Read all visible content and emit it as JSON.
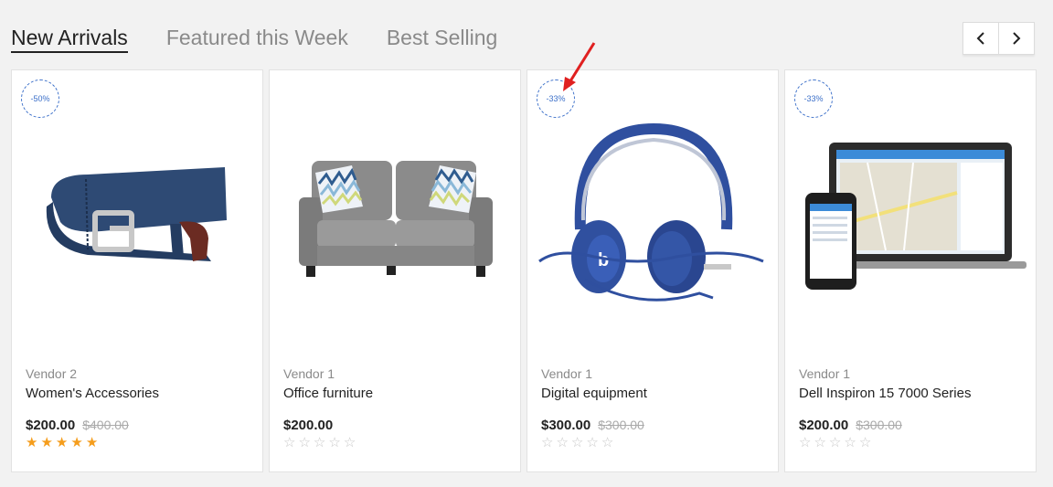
{
  "tabs": [
    {
      "label": "New Arrivals",
      "active": true
    },
    {
      "label": "Featured this Week",
      "active": false
    },
    {
      "label": "Best Selling",
      "active": false
    }
  ],
  "nav": {
    "prev_icon": "chevron-left-icon",
    "next_icon": "chevron-right-icon"
  },
  "products": [
    {
      "badge": "-50%",
      "vendor": "Vendor 2",
      "title": "Women's Accessories",
      "price": "$200.00",
      "old_price": "$400.00",
      "rating": 5,
      "image": "belt"
    },
    {
      "badge": "",
      "vendor": "Vendor 1",
      "title": "Office furniture",
      "price": "$200.00",
      "old_price": "",
      "rating": 0,
      "image": "sofa"
    },
    {
      "badge": "-33%",
      "vendor": "Vendor 1",
      "title": "Digital equipment",
      "price": "$300.00",
      "old_price": "$300.00",
      "rating": 0,
      "image": "headphones"
    },
    {
      "badge": "-33%",
      "vendor": "Vendor 1",
      "title": "Dell Inspiron 15 7000 Series",
      "price": "$200.00",
      "old_price": "$300.00",
      "rating": 0,
      "image": "laptop-phone"
    }
  ],
  "colors": {
    "accent": "#3b6fc9",
    "star": "#f59d1c",
    "annotation_arrow": "#e02020"
  }
}
